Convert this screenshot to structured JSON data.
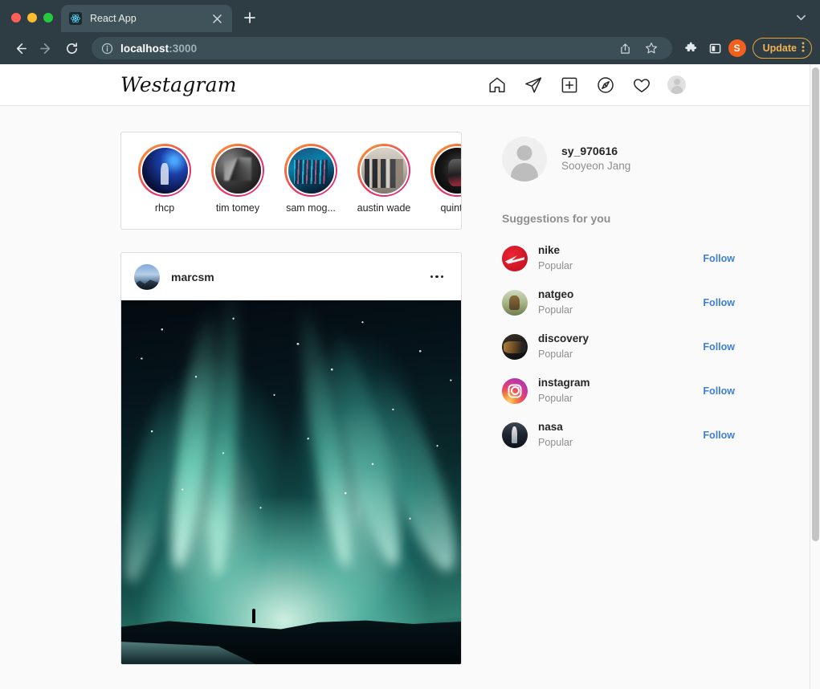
{
  "browser": {
    "tab": {
      "title": "React App",
      "favicon": "react-atom-icon"
    },
    "new_tab_label": "+",
    "address": {
      "host": "localhost",
      "port": ":3000",
      "info_icon": "info-circle-icon"
    },
    "actions": {
      "back": "back-arrow-icon",
      "forward": "forward-arrow-icon",
      "reload": "reload-icon",
      "share": "share-icon",
      "bookmark": "star-icon",
      "extensions": "puzzle-icon",
      "sidepanel": "side-panel-icon",
      "profile_initial": "S",
      "update_label": "Update",
      "menu": "three-dot-menu-icon",
      "tab_search": "chevron-down-icon"
    }
  },
  "app": {
    "logo": "Westagram",
    "nav": [
      {
        "name": "home-icon",
        "label": "Home"
      },
      {
        "name": "paper-plane-icon",
        "label": "Direct"
      },
      {
        "name": "plus-square-icon",
        "label": "New Post"
      },
      {
        "name": "compass-icon",
        "label": "Explore"
      },
      {
        "name": "heart-icon",
        "label": "Activity"
      },
      {
        "name": "profile-avatar",
        "label": "Profile"
      }
    ]
  },
  "stories": [
    {
      "name": "rhcp",
      "avatar": "ph-rhcp"
    },
    {
      "name": "tim tomey",
      "avatar": "ph-tim"
    },
    {
      "name": "sam mog...",
      "avatar": "ph-sam"
    },
    {
      "name": "austin wade",
      "avatar": "ph-austin"
    },
    {
      "name": "quinton",
      "avatar": "ph-quinton"
    }
  ],
  "post": {
    "username": "marcsm",
    "avatar": "ph-marcsm",
    "more_menu": "three-dot-menu-icon",
    "image_alt": "aurora borealis over dark landscape with lone figure"
  },
  "profile": {
    "username": "sy_970616",
    "fullname": "Sooyeon Jang",
    "avatar": "default-person-avatar"
  },
  "suggestions": {
    "title": "Suggestions for you",
    "follow_label": "Follow",
    "items": [
      {
        "name": "nike",
        "subtitle": "Popular",
        "avatar": "av-nike"
      },
      {
        "name": "natgeo",
        "subtitle": "Popular",
        "avatar": "av-natgeo"
      },
      {
        "name": "discovery",
        "subtitle": "Popular",
        "avatar": "av-discovery"
      },
      {
        "name": "instagram",
        "subtitle": "Popular",
        "avatar": "av-instagram"
      },
      {
        "name": "nasa",
        "subtitle": "Popular",
        "avatar": "av-nasa"
      }
    ]
  },
  "colors": {
    "chrome": "#2e3d43",
    "tab_active": "#40535b",
    "omnibox": "#3c4f57",
    "update_accent": "#f0b254",
    "profile_badge": "#f3601d",
    "page_bg": "#fafafa",
    "card_border": "#dbdbdb",
    "text_primary": "#262626",
    "text_secondary": "#8e8e8e",
    "link_blue": "#3e7fd4",
    "story_ring_from": "#f9a03d",
    "story_ring_to": "#d62976"
  }
}
